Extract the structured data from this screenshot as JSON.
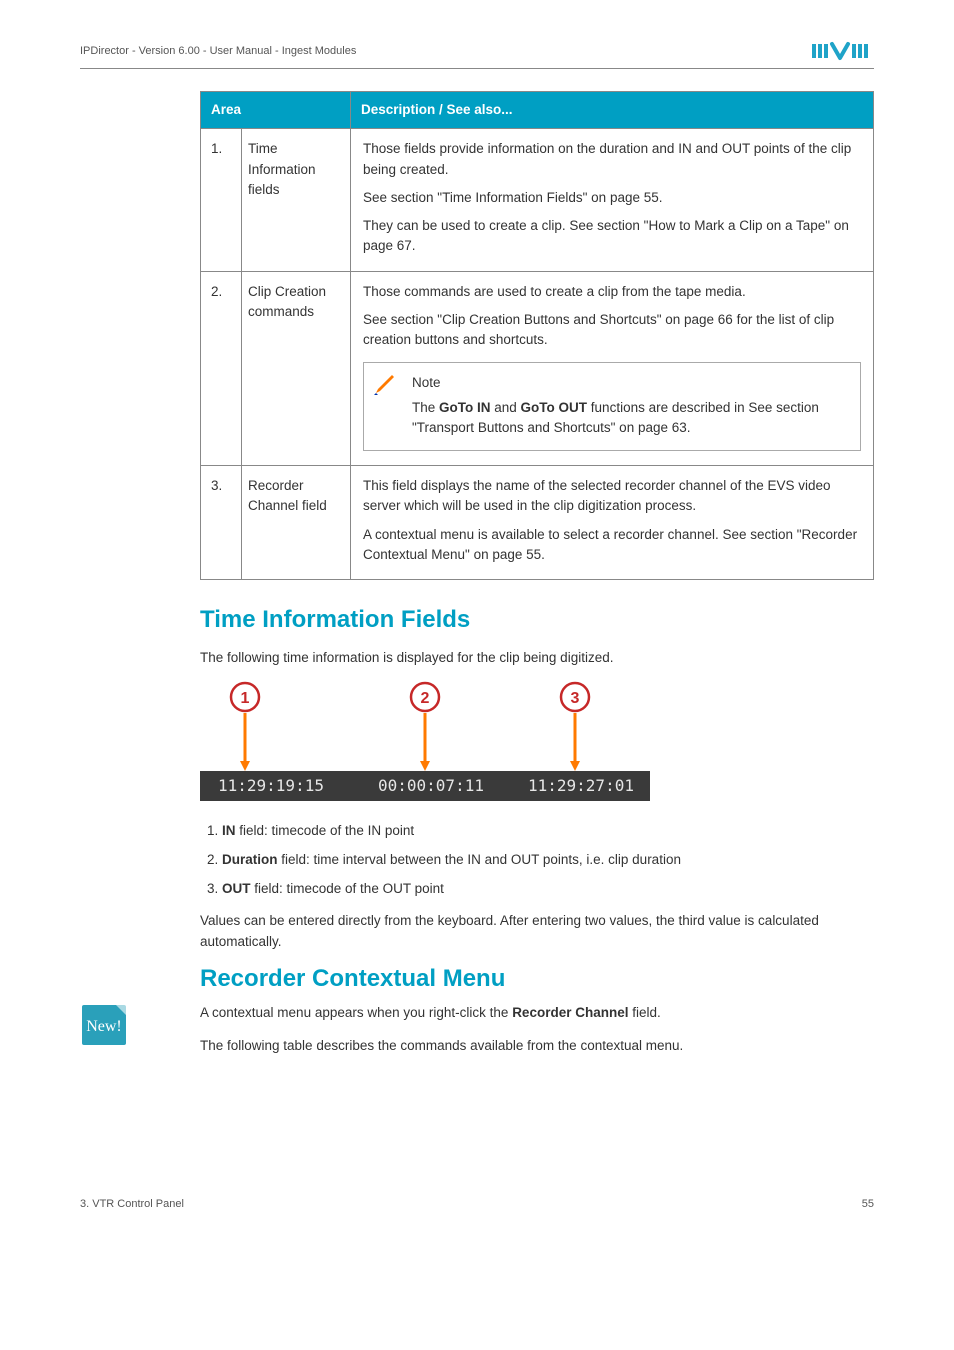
{
  "header": {
    "left": "IPDirector - Version 6.00 - User Manual - Ingest Modules"
  },
  "table": {
    "headers": [
      "Area",
      "Description / See also..."
    ],
    "rows": [
      {
        "num": "1.",
        "title": "Time Information fields",
        "desc": [
          "Those fields provide information on the duration and IN and OUT points of the clip being created.",
          "See section \"Time Information Fields\" on page 55.",
          "They can be used to create a clip. See section \"How to Mark a Clip on a Tape\" on page 67."
        ],
        "note": null
      },
      {
        "num": "2.",
        "title": "Clip Creation commands",
        "desc": [
          "Those commands are used to create a clip from the tape media.",
          "See section \"Clip Creation Buttons and Shortcuts\" on page 66 for the list of clip creation buttons and shortcuts."
        ],
        "note": {
          "title": "Note",
          "body_prefix": "The ",
          "body_bold1": "GoTo IN",
          "body_mid": " and ",
          "body_bold2": "GoTo OUT",
          "body_suffix": " functions are described in See section \"Transport Buttons and Shortcuts\" on page 63."
        }
      },
      {
        "num": "3.",
        "title": "Recorder Channel field",
        "desc": [
          "This field displays the name of the selected recorder channel of the EVS video server which will be used in the clip digitization process.",
          "A contextual menu is available to select a recorder channel. See section \"Recorder Contextual Menu\" on page 55."
        ],
        "note": null
      }
    ]
  },
  "section1": {
    "title": "Time Information Fields",
    "intro": "The following time information is displayed for the clip being digitized.",
    "timecodes": [
      "11:29:19:15",
      "00:00:07:11",
      "11:29:27:01"
    ],
    "circleLabels": [
      "1",
      "2",
      "3"
    ],
    "list": [
      {
        "pre": "",
        "bold": "IN",
        "post": " field: timecode of the IN point"
      },
      {
        "pre": "",
        "bold": "Duration",
        "post": " field: time interval between the IN and OUT points, i.e. clip duration"
      },
      {
        "pre": "",
        "bold": "OUT",
        "post": " field: timecode of the OUT point"
      }
    ],
    "outro": "Values can be entered directly from the keyboard. After entering two values, the third value is calculated automatically."
  },
  "section2": {
    "title": "Recorder Contextual Menu",
    "p1_pre": "A contextual menu appears when you right-click the ",
    "p1_bold": "Recorder Channel",
    "p1_post": " field.",
    "p2": "The following table describes the commands available from the contextual menu."
  },
  "newTagLabel": "New!",
  "footer": {
    "left": "3. VTR Control Panel",
    "right": "55"
  }
}
